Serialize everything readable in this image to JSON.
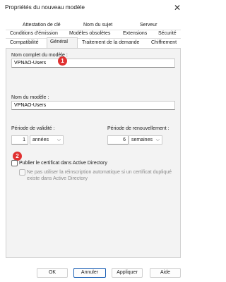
{
  "window": {
    "title": "Propriétés du nouveau modèle",
    "close_symbol": "✕"
  },
  "tabs": {
    "row1": [
      "Attestation de clé",
      "Nom du sujet",
      "Serveur"
    ],
    "row2": [
      "Conditions d'émission",
      "Modèles obsolètes",
      "Extensions",
      "Sécurité"
    ],
    "row3": [
      "Compatibilité",
      "Général",
      "Traitement de la demande",
      "Chiffrement"
    ],
    "active": "Général"
  },
  "general": {
    "full_name_label": "Nom complet du modèle :",
    "full_name_value": "VPNAO-Users",
    "name_label": "Nom du modèle :",
    "name_value": "VPNAO-Users",
    "validity_label": "Période de validité :",
    "validity_value": "1",
    "validity_unit": "années",
    "renewal_label": "Période de renouvellement :",
    "renewal_value": "6",
    "renewal_unit": "semaines",
    "publish_label": "Publier le certificat dans Active Directory",
    "no_reenroll_label_line1": "Ne pas utiliser la réinscription automatique si un certificat dupliqué",
    "no_reenroll_label_line2": "existe dans Active Directory"
  },
  "annotations": {
    "badge1": "1",
    "badge2": "2",
    "badge_color": "#e03131"
  },
  "buttons": {
    "ok": "OK",
    "cancel": "Annuler",
    "apply": "Appliquer",
    "help": "Aide"
  },
  "colors": {
    "panel_bg": "#f3f3f3",
    "primary_border": "#1a5fb4"
  }
}
